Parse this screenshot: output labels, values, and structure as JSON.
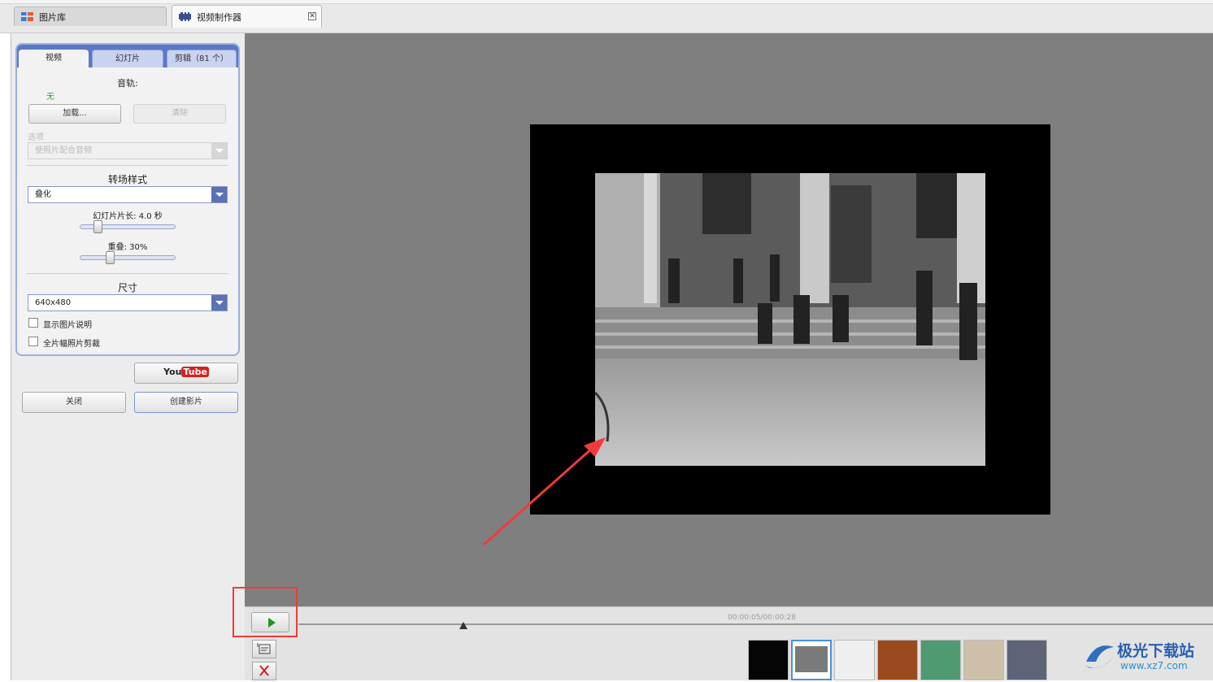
{
  "window": {
    "tabs": [
      {
        "label": "图片库"
      },
      {
        "label": "视频制作器"
      }
    ]
  },
  "panel": {
    "tabs": [
      "视频",
      "幻灯片",
      "剪辑（81 个）"
    ],
    "audio_label": "音轨:",
    "audio_value": "无",
    "load_button": "加载...",
    "clear_button": "清除",
    "options_label": "选项",
    "options_select": "使照片配合音频",
    "transition_label": "转场样式",
    "transition_value": "叠化",
    "slide_length_label": "幻灯片片长: 4.0 秒",
    "slide_length_seconds": 4.0,
    "overlap_label": "重叠: 30%",
    "overlap_percent": 30,
    "size_label": "尺寸",
    "size_value": "640x480",
    "checkbox_captions": "显示图片说明",
    "checkbox_fullframe": "全片幅照片剪裁",
    "youtube_label_you": "You",
    "youtube_label_tube": "Tube",
    "close_button": "关闭",
    "create_button": "创建影片"
  },
  "player": {
    "time": "00:00:05/00:00:28",
    "playhead_fraction": 0.18
  },
  "filmstrip": {
    "items": [
      {
        "name": "title-slide",
        "color": "#050505"
      },
      {
        "name": "photo-slide",
        "color": "#7a7a7a"
      },
      {
        "name": "white-texture",
        "color": "#efefef"
      },
      {
        "name": "brown-texture",
        "color": "#9a4a1e"
      },
      {
        "name": "green-texture",
        "color": "#4f9a70"
      },
      {
        "name": "beige-texture",
        "color": "#cdbfa8"
      },
      {
        "name": "blue-texture",
        "color": "#5d6478"
      }
    ]
  },
  "watermark": {
    "title": "极光下载站",
    "url": "www.xz7.com"
  },
  "colors": {
    "accent": "#5b78c7",
    "annotation": "#f13a3a"
  }
}
